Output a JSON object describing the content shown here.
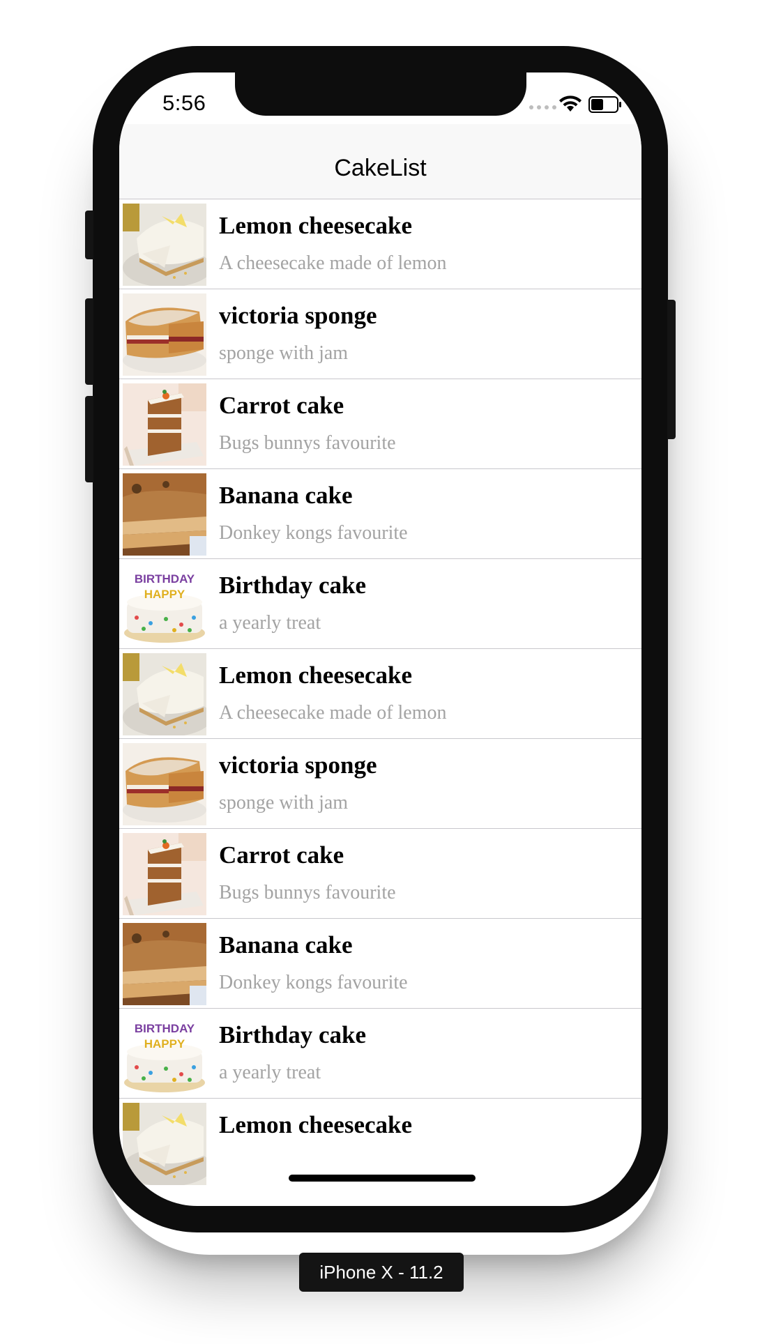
{
  "status_bar": {
    "time": "5:56"
  },
  "nav": {
    "title": "CakeList"
  },
  "rows": [
    {
      "title": "Lemon cheesecake",
      "subtitle": "A cheesecake made of lemon",
      "image": "lemon-cheesecake"
    },
    {
      "title": "victoria sponge",
      "subtitle": "sponge with jam",
      "image": "victoria-sponge"
    },
    {
      "title": "Carrot cake",
      "subtitle": "Bugs bunnys favourite",
      "image": "carrot-cake"
    },
    {
      "title": "Banana cake",
      "subtitle": "Donkey kongs favourite",
      "image": "banana-cake"
    },
    {
      "title": "Birthday cake",
      "subtitle": "a yearly treat",
      "image": "birthday-cake"
    },
    {
      "title": "Lemon cheesecake",
      "subtitle": "A cheesecake made of lemon",
      "image": "lemon-cheesecake"
    },
    {
      "title": "victoria sponge",
      "subtitle": "sponge with jam",
      "image": "victoria-sponge"
    },
    {
      "title": "Carrot cake",
      "subtitle": "Bugs bunnys favourite",
      "image": "carrot-cake"
    },
    {
      "title": "Banana cake",
      "subtitle": "Donkey kongs favourite",
      "image": "banana-cake"
    },
    {
      "title": "Birthday cake",
      "subtitle": "a yearly treat",
      "image": "birthday-cake"
    },
    {
      "title": "Lemon cheesecake",
      "image": "lemon-cheesecake"
    }
  ],
  "device_label": "iPhone X - 11.2"
}
